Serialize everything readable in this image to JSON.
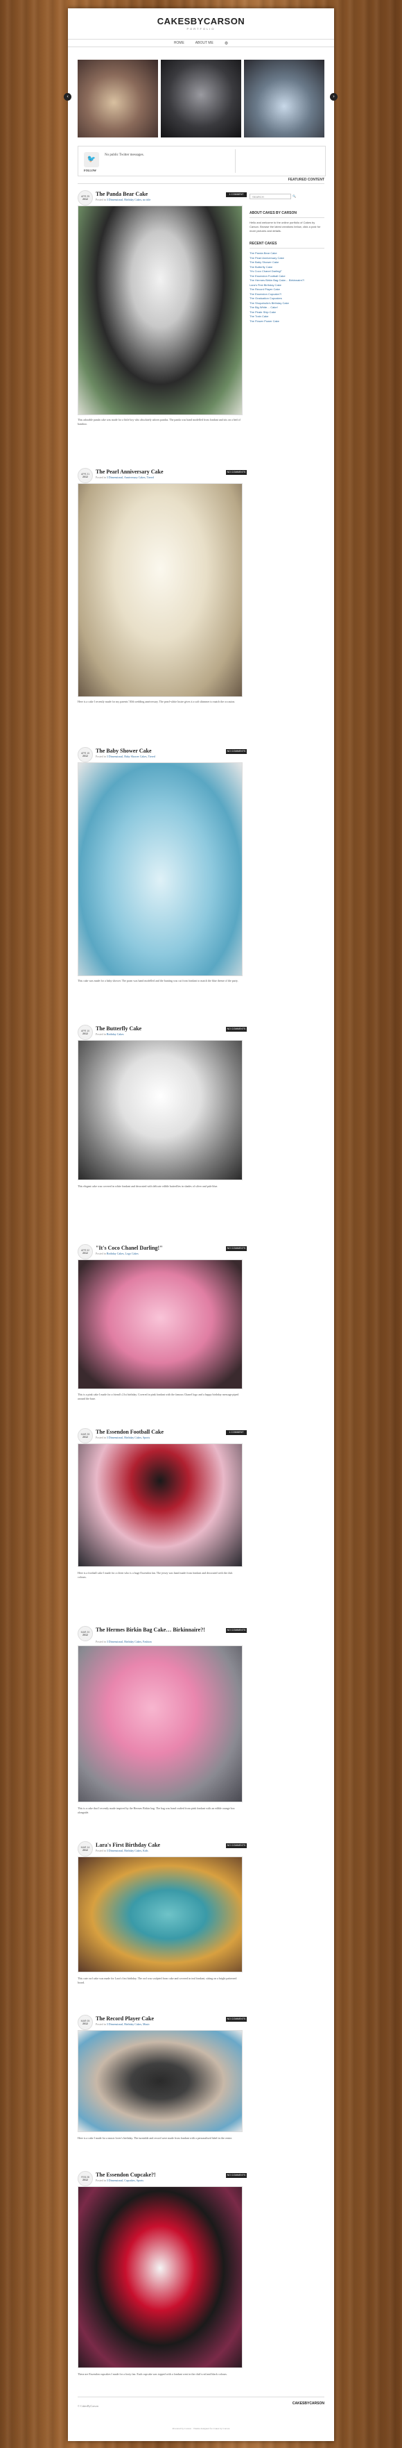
{
  "site": {
    "title": "CAKESBYCARSON",
    "subtitle": "PORTFOLIO"
  },
  "nav": {
    "items": [
      "HOME",
      "ABOUT ME"
    ],
    "gear_label": "⚙"
  },
  "slider": {
    "prev_label": "‹",
    "next_label": "›"
  },
  "twitter": {
    "message": "No public Twitter messages.",
    "follow_label": "FOLLOW"
  },
  "featured_label": "FEATURED CONTENT",
  "sidebar": {
    "search_placeholder": "SEARCH",
    "search_button": "🔍",
    "about_title": "ABOUT CAKES BY CARSON",
    "about_text": "Hello and welcome to the online portfolio of Cakes by Carson. Browse the latest creations below, click a post for more pictures and details.",
    "recent_title": "RECENT CAKES",
    "recent_items": [
      "The Panda Bear Cake",
      "The Pearl Anniversary Cake",
      "The Baby Shower Cake",
      "The Butterfly Cake",
      "\"It's Coco Chanel Darling!\"",
      "The Essendon Football Cake",
      "The Hermes Birkin Bag Cake… Birkinnaire?!",
      "Lara's First Birthday Cake",
      "The Record Player Cake",
      "The Essendon Cupcake?!",
      "The Graduation Cupcakes",
      "The Shopaholic's Birthday Cake",
      "The Big White… Cake!",
      "The Pirate Ship Cake",
      "The Train Cake",
      "The Flower Power Cake"
    ]
  },
  "posts": [
    {
      "day": "APR 25",
      "year": "2012",
      "title": "The Panda Bear Cake",
      "meta_prefix": "Posted in",
      "categories": "3 Dimensional, Birthday Cakes, no title",
      "comments": "1 COMMENT",
      "body": "This adorable panda cake was made for a little boy who absolutely adores pandas. The panda was hand modelled from fondant and sits on a bed of bamboo."
    },
    {
      "day": "APR 21",
      "year": "2012",
      "title": "The Pearl Anniversary Cake",
      "meta_prefix": "Posted in",
      "categories": "3 Dimensional, Anniversary Cakes, Tiered",
      "comments": "NO COMMENTS",
      "body": "Here is a cake I recently made for my parents' 30th wedding anniversary. The pearl-white lustre gives it a soft shimmer to match the occasion."
    },
    {
      "day": "APR 15",
      "year": "2012",
      "title": "The Baby Shower Cake",
      "meta_prefix": "Posted in",
      "categories": "3 Dimensional, Baby Shower Cakes, Tiered",
      "comments": "NO COMMENTS",
      "body": "This cake was made for a baby shower. The pram was hand modelled and the bunting was cut from fondant to match the blue theme of the party."
    },
    {
      "day": "APR 10",
      "year": "2012",
      "title": "The Butterfly Cake",
      "meta_prefix": "Posted in",
      "categories": "Birthday Cakes",
      "comments": "NO COMMENTS",
      "body": "This elegant cake was covered in white fondant and decorated with delicate edible butterflies in shades of silver and pale blue."
    },
    {
      "day": "APR 02",
      "year": "2012",
      "title": "\"It's Coco Chanel Darling!\"",
      "meta_prefix": "Posted in",
      "categories": "Birthday Cakes, Logo Cakes",
      "comments": "NO COMMENTS",
      "body": "This is a pink cake I made for a friend's 21st birthday. Covered in pink fondant with the famous Chanel logo and a happy birthday message piped around the base."
    },
    {
      "day": "MAR 28",
      "year": "2012",
      "title": "The Essendon Football Cake",
      "meta_prefix": "Posted in",
      "categories": "3 Dimensional, Birthday Cakes, Sports",
      "comments": "1 COMMENT",
      "body": "Here is a football cake I made for a client who is a huge Essendon fan. The jersey was hand made from fondant and decorated with the club colours."
    },
    {
      "day": "MAR 20",
      "year": "2012",
      "title": "The Hermes Birkin Bag Cake… Birkinnaire?!",
      "meta_prefix": "Posted in",
      "categories": "3 Dimensional, Birthday Cakes, Fashion",
      "comments": "NO COMMENTS",
      "body": "This is a cake that I recently made inspired by the Hermes Birkin bag. The bag was hand crafted from pink fondant with an edible orange box alongside."
    },
    {
      "day": "MAR 14",
      "year": "2012",
      "title": "Lara's First Birthday Cake",
      "meta_prefix": "Posted in",
      "categories": "3 Dimensional, Birthday Cakes, Kids",
      "comments": "NO COMMENTS",
      "body": "This cute owl cake was made for Lara's first birthday. The owl was sculpted from cake and covered in teal fondant, sitting on a bright patterned board."
    },
    {
      "day": "MAR 05",
      "year": "2012",
      "title": "The Record Player Cake",
      "meta_prefix": "Posted in",
      "categories": "3 Dimensional, Birthday Cakes, Music",
      "comments": "NO COMMENTS",
      "body": "Here is a cake I made for a music lover's birthday. The turntable and record were made from fondant with a personalised label in the centre."
    },
    {
      "day": "FEB 28",
      "year": "2012",
      "title": "The Essendon Cupcake?!",
      "meta_prefix": "Posted in",
      "categories": "3 Dimensional, Cupcakes, Sports",
      "comments": "NO COMMENTS",
      "body": "These are Essendon cupcakes I made for a footy fan. Each cupcake was topped with a fondant crest in the club's red and black colours."
    }
  ],
  "footer": {
    "copyright": "© CakesByCarson",
    "brand": "CAKESBYCARSON",
    "links": "Powered by Carson · Theme designed for Cakes by Carson"
  }
}
